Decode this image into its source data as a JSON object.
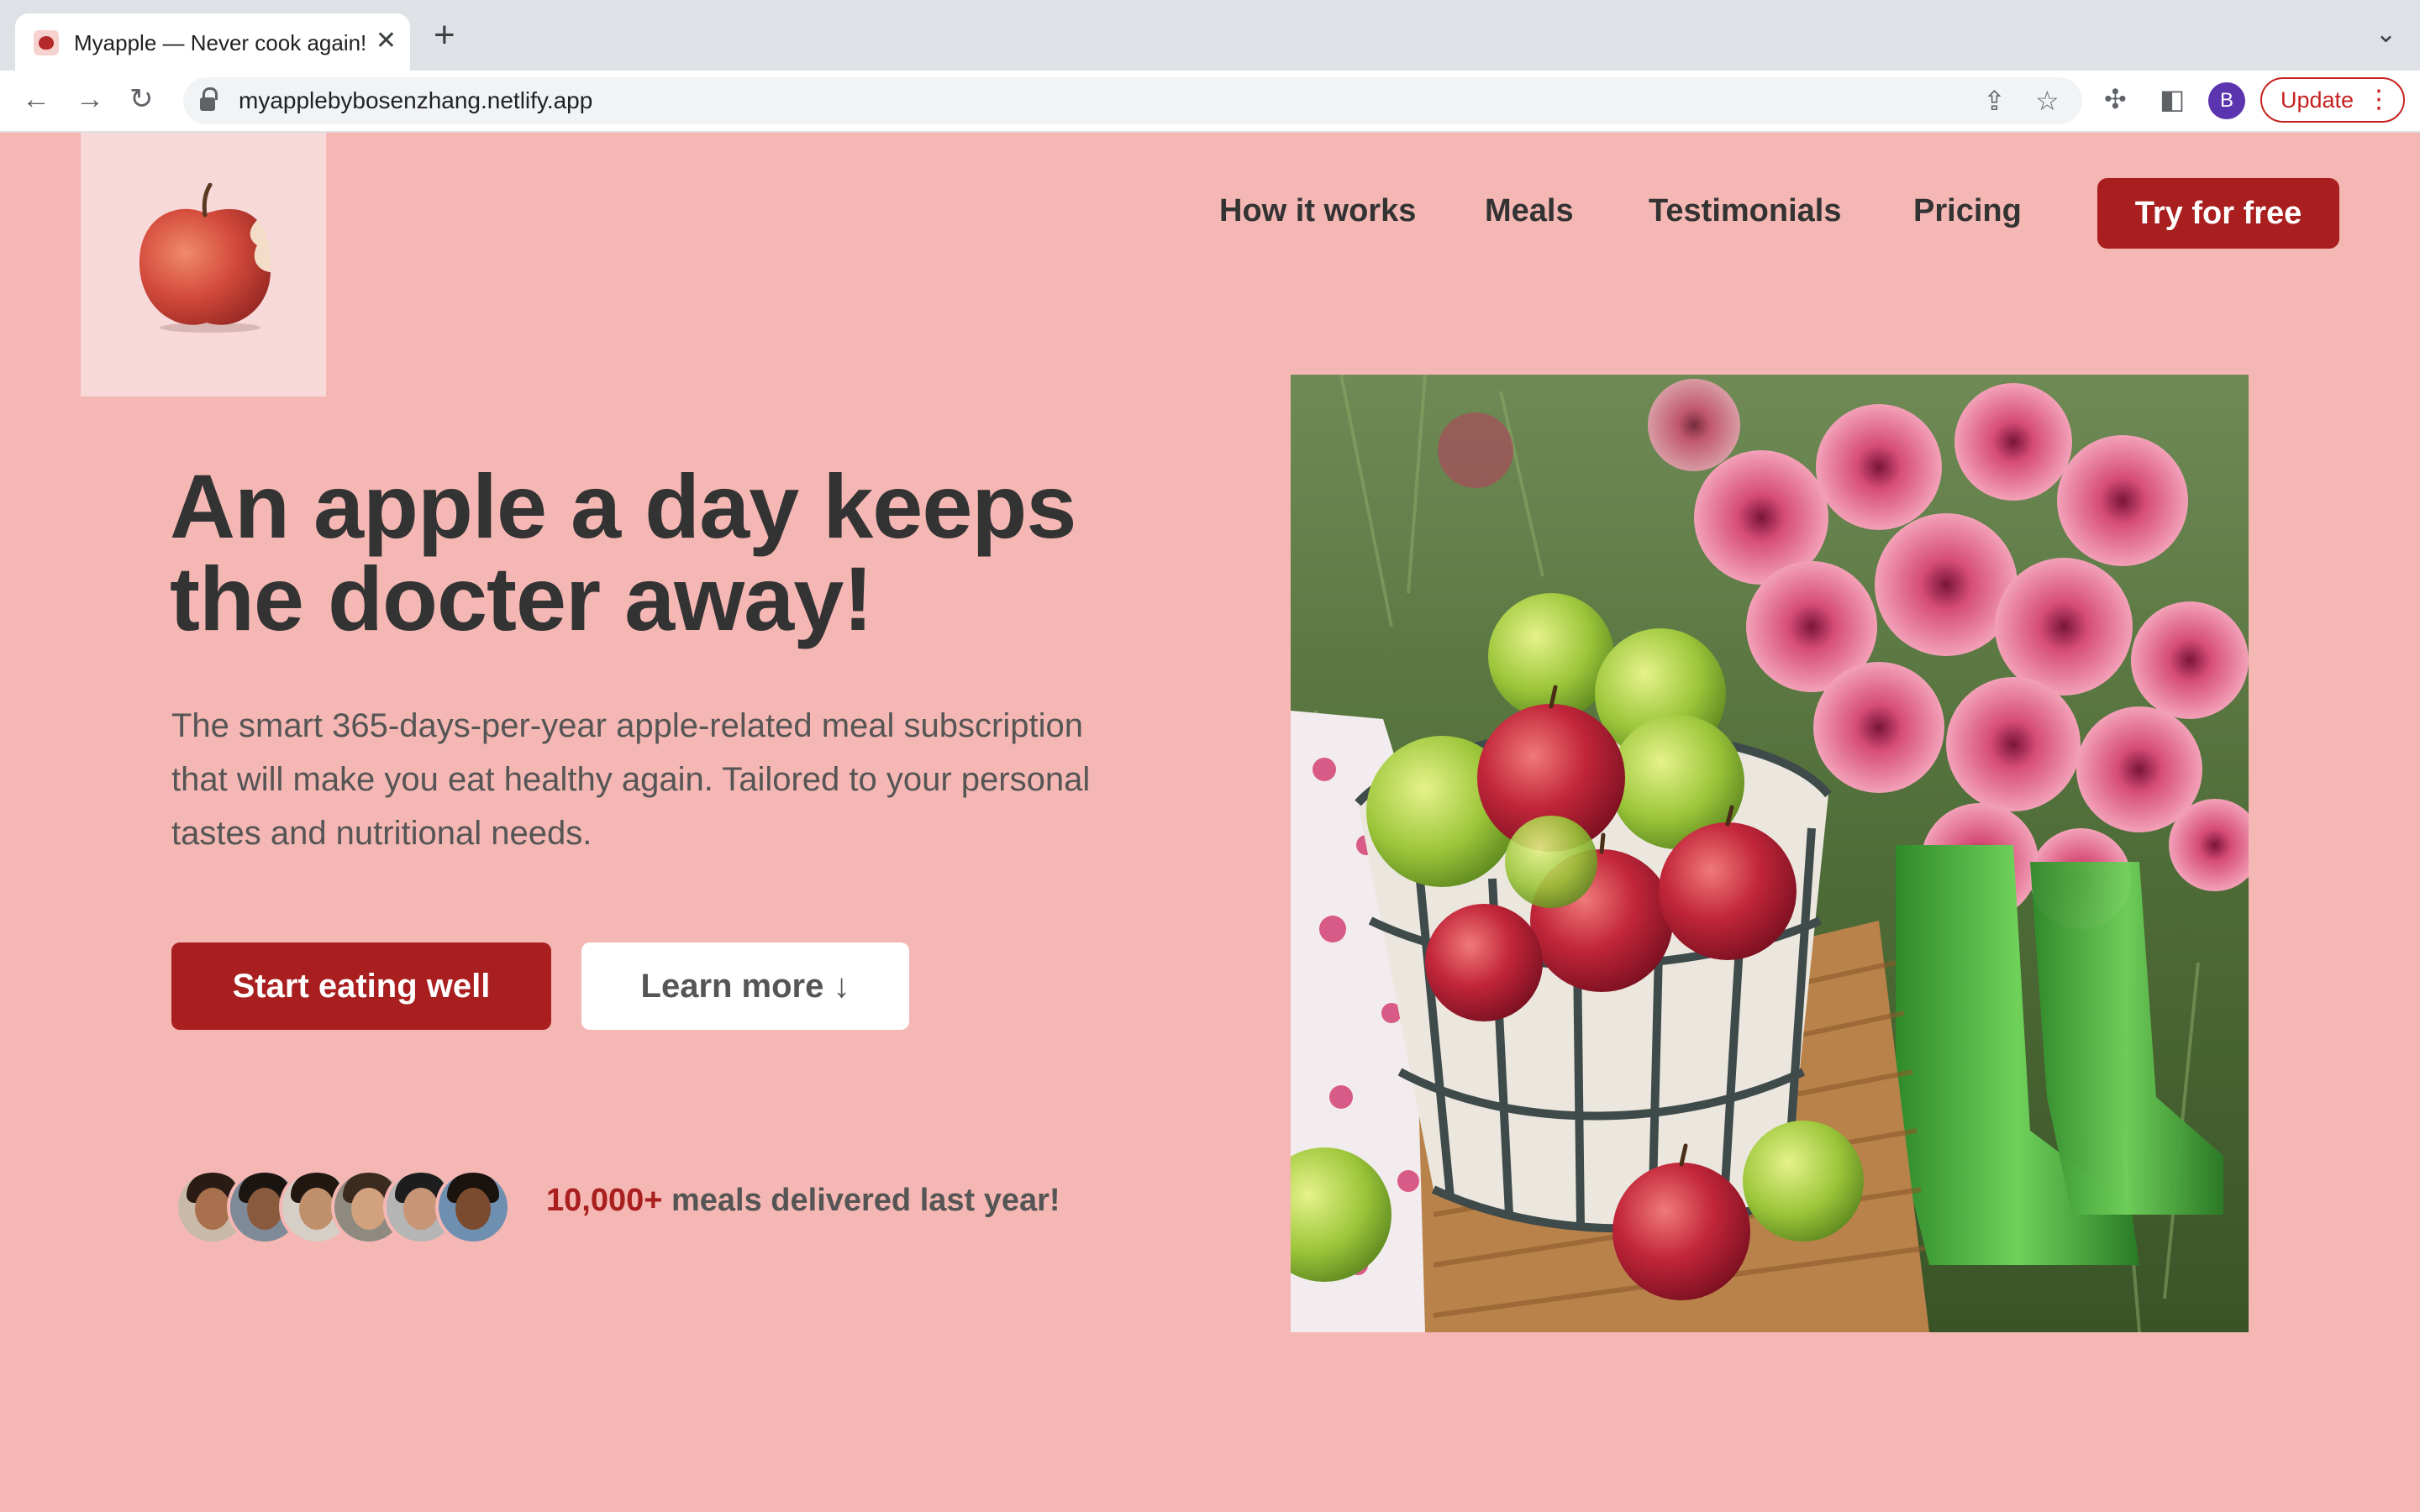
{
  "browser": {
    "tab_title": "Myapple — Never cook again!",
    "url": "myapplebybosenzhang.netlify.app",
    "profile_initial": "B",
    "update_label": "Update"
  },
  "nav": {
    "links": [
      "How it works",
      "Meals",
      "Testimonials",
      "Pricing"
    ],
    "cta": "Try for free"
  },
  "hero": {
    "title": "An apple a day keeps the docter away!",
    "subtitle": "The smart 365-days-per-year apple-related meal subscription that will make you eat healthy again. Tailored to your personal tastes and nutritional needs.",
    "primary_button": "Start eating well",
    "secondary_button": "Learn more ↓",
    "delivered_count": "10,000+",
    "delivered_text": " meals delivered last year!"
  },
  "colors": {
    "page_background": "#f4b7b3",
    "brand_red": "#a91e1e",
    "heading": "#333333",
    "body_text": "#555555"
  },
  "icons": [
    "back-icon",
    "forward-icon",
    "reload-icon",
    "lock-icon",
    "share-icon",
    "bookmark-star-icon",
    "extensions-icon",
    "side-panel-icon",
    "chevron-down-icon",
    "close-icon",
    "plus-icon"
  ]
}
